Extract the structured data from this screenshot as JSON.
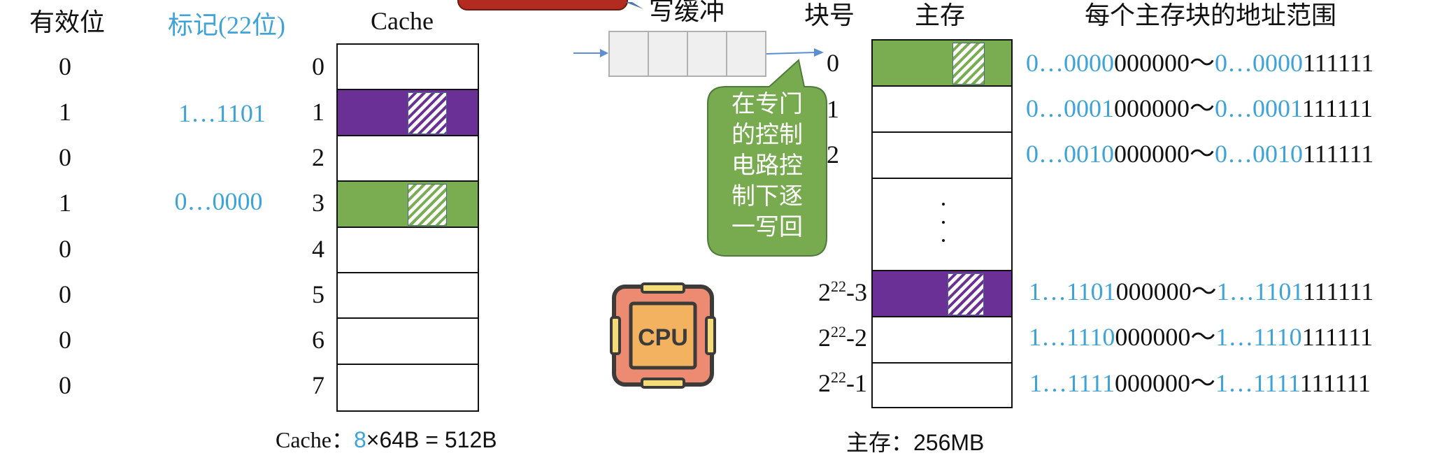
{
  "headers": {
    "valid_bit": "有效位",
    "tag": "标记(22位)",
    "cache": "Cache",
    "write_buffer": "写缓冲",
    "block_no": "块号",
    "main_memory": "主存",
    "address_range": "每个主存块的地址范围"
  },
  "cache": {
    "lines": [
      {
        "index": "0",
        "valid": "0",
        "tag": "",
        "fill": "empty"
      },
      {
        "index": "1",
        "valid": "1",
        "tag": "1…1101",
        "fill": "purple"
      },
      {
        "index": "2",
        "valid": "0",
        "tag": "",
        "fill": "empty"
      },
      {
        "index": "3",
        "valid": "1",
        "tag": "0…0000",
        "fill": "green"
      },
      {
        "index": "4",
        "valid": "0",
        "tag": "",
        "fill": "empty"
      },
      {
        "index": "5",
        "valid": "0",
        "tag": "",
        "fill": "empty"
      },
      {
        "index": "6",
        "valid": "0",
        "tag": "",
        "fill": "empty"
      },
      {
        "index": "7",
        "valid": "0",
        "tag": "",
        "fill": "empty"
      }
    ],
    "caption_prefix": "Cache：",
    "caption_count": "8",
    "caption_rest": "×64B = 512B"
  },
  "write_buffer": {
    "cells": 4
  },
  "callout": {
    "text": "在专门的控制电路控制下逐一写回",
    "lines": [
      "在专门",
      "的控制",
      "电路控",
      "制下逐",
      "一写回"
    ]
  },
  "cpu": {
    "label": "CPU"
  },
  "main_memory": {
    "blocks": [
      {
        "label": "0",
        "fill": "green",
        "addr_start_tag": "0…0000",
        "addr_start_off": "000000",
        "addr_end_tag": "0…0000",
        "addr_end_off": "111111"
      },
      {
        "label": "1",
        "fill": "empty",
        "addr_start_tag": "0…0001",
        "addr_start_off": "000000",
        "addr_end_tag": "0…0001",
        "addr_end_off": "111111"
      },
      {
        "label": "2",
        "fill": "empty",
        "addr_start_tag": "0…0010",
        "addr_start_off": "000000",
        "addr_end_tag": "0…0010",
        "addr_end_off": "111111"
      },
      {
        "label": "…",
        "fill": "ellipsis"
      },
      {
        "label_base": "2",
        "label_exp": "22",
        "label_suffix": "-3",
        "fill": "purple",
        "addr_start_tag": "1…1101",
        "addr_start_off": "000000",
        "addr_end_tag": "1…1101",
        "addr_end_off": "111111"
      },
      {
        "label_base": "2",
        "label_exp": "22",
        "label_suffix": "-2",
        "fill": "empty",
        "addr_start_tag": "1…1110",
        "addr_start_off": "000000",
        "addr_end_tag": "1…1110",
        "addr_end_off": "111111"
      },
      {
        "label_base": "2",
        "label_exp": "22",
        "label_suffix": "-1",
        "fill": "empty",
        "addr_start_tag": "1…1111",
        "addr_start_off": "000000",
        "addr_end_tag": "1…1111",
        "addr_end_off": "111111"
      }
    ],
    "tilde": "～",
    "caption": "主存：256MB"
  },
  "colors": {
    "purple": "#6a3095",
    "green": "#7aad52",
    "tag_blue": "#3fa3d8",
    "callout_green": "#78ab50",
    "callout_red": "#b22a20"
  }
}
